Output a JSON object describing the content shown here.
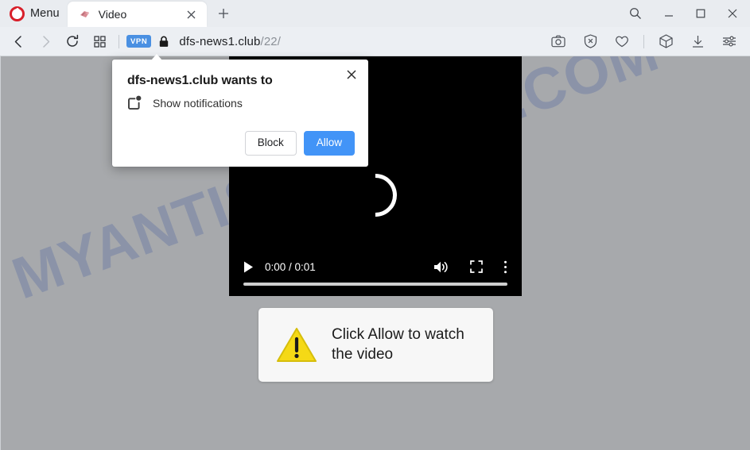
{
  "browser": {
    "menu_label": "Menu",
    "tab": {
      "title": "Video",
      "favicon": "video-favicon",
      "close": "×"
    },
    "new_tab": "+",
    "window_controls": {
      "search": "search-icon",
      "minimize": "minimize-icon",
      "maximize": "maximize-icon",
      "close": "close-icon"
    },
    "nav": {
      "back": "back-arrow-icon",
      "forward": "forward-arrow-icon",
      "reload": "reload-icon",
      "tiles": "speed-dial-icon"
    },
    "address": {
      "vpn_badge": "VPN",
      "lock": "lock-icon",
      "host": "dfs-news1.club",
      "path": "/22/"
    },
    "right_icons": [
      {
        "name": "snapshot-icon",
        "label": "Snapshot"
      },
      {
        "name": "ad-blocker-icon",
        "label": "Ad blocker"
      },
      {
        "name": "heart-icon",
        "label": "Add to favorites"
      },
      {
        "name": "workspaces-icon",
        "label": "Workspaces"
      },
      {
        "name": "downloads-icon",
        "label": "Downloads"
      },
      {
        "name": "easy-setup-icon",
        "label": "Easy setup"
      }
    ]
  },
  "page": {
    "watermark": "MYANTISPYWARE.COM",
    "background_color": "#a7a9ac",
    "video": {
      "state": "loading",
      "current_time": "0:00",
      "duration": "0:01",
      "time_display": "0:00 / 0:01",
      "controls": {
        "play": "play-icon",
        "volume": "volume-icon",
        "fullscreen": "fullscreen-icon",
        "more": "more-options-icon"
      }
    },
    "warning": {
      "icon": "warning-triangle-icon",
      "line1": "Click Allow to watch",
      "line2": "the video",
      "icon_color": "#f5d916"
    }
  },
  "permission_dialog": {
    "title": "dfs-news1.club wants to",
    "permission_icon": "notifications-icon",
    "permission_label": "Show notifications",
    "close_label": "×",
    "buttons": {
      "block": "Block",
      "allow": "Allow"
    },
    "allow_color": "#4294f7"
  }
}
